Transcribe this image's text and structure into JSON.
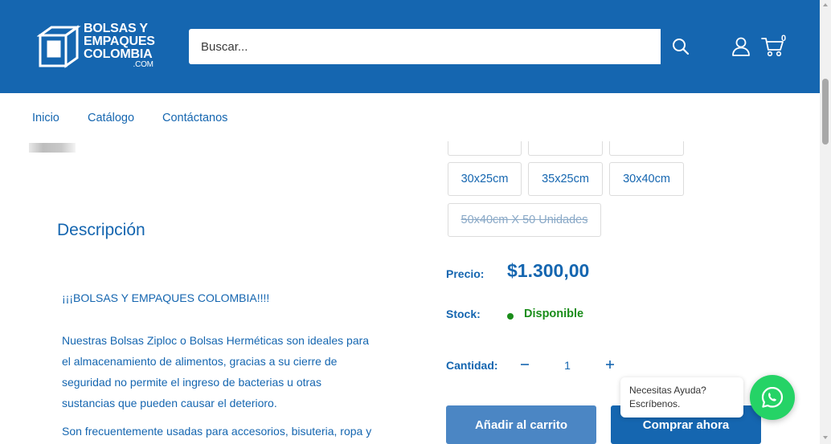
{
  "header": {
    "logo": {
      "line1": "BOLSAS Y",
      "line2": "EMPAQUES",
      "line3": "COLOMBIA",
      "suffix": ".COM"
    },
    "search": {
      "placeholder": "Buscar..."
    },
    "cart_count": "0",
    "colors": {
      "brand": "#1566b0",
      "text_on_brand": "#ffffff"
    }
  },
  "nav": {
    "items": [
      "Inicio",
      "Catálogo",
      "Contáctanos"
    ]
  },
  "product": {
    "size_options": [
      "30x25cm",
      "35x25cm",
      "30x40cm",
      "50x40cm X 50 Unidades"
    ],
    "price_label": "Precio:",
    "price": "$1.300,00",
    "stock_label": "Stock:",
    "stock_value": "Disponible",
    "quantity_label": "Cantidad:",
    "quantity": "1",
    "add_to_cart": "Añadir al carrito",
    "buy_now": "Comprar ahora"
  },
  "description": {
    "title": "Descripción",
    "p1": "¡¡¡BOLSAS Y EMPAQUES COLOMBIA!!!!",
    "p2": "Nuestras Bolsas Ziploc o Bolsas Herméticas son ideales para el almacenamiento de alimentos, gracias a su cierre de seguridad no permite el ingreso de bacterias u otras sustancias que pueden causar el deterioro.",
    "p3": "Son frecuentemente usadas para accesorios, bisuteria, ropa y"
  },
  "whatsapp": {
    "line1": "Necesitas Ayuda?",
    "line2": "Escríbenos.",
    "color": "#25d366"
  },
  "icons": [
    "search-icon",
    "user-icon",
    "cart-icon",
    "minus-icon",
    "plus-icon",
    "whatsapp-icon"
  ]
}
